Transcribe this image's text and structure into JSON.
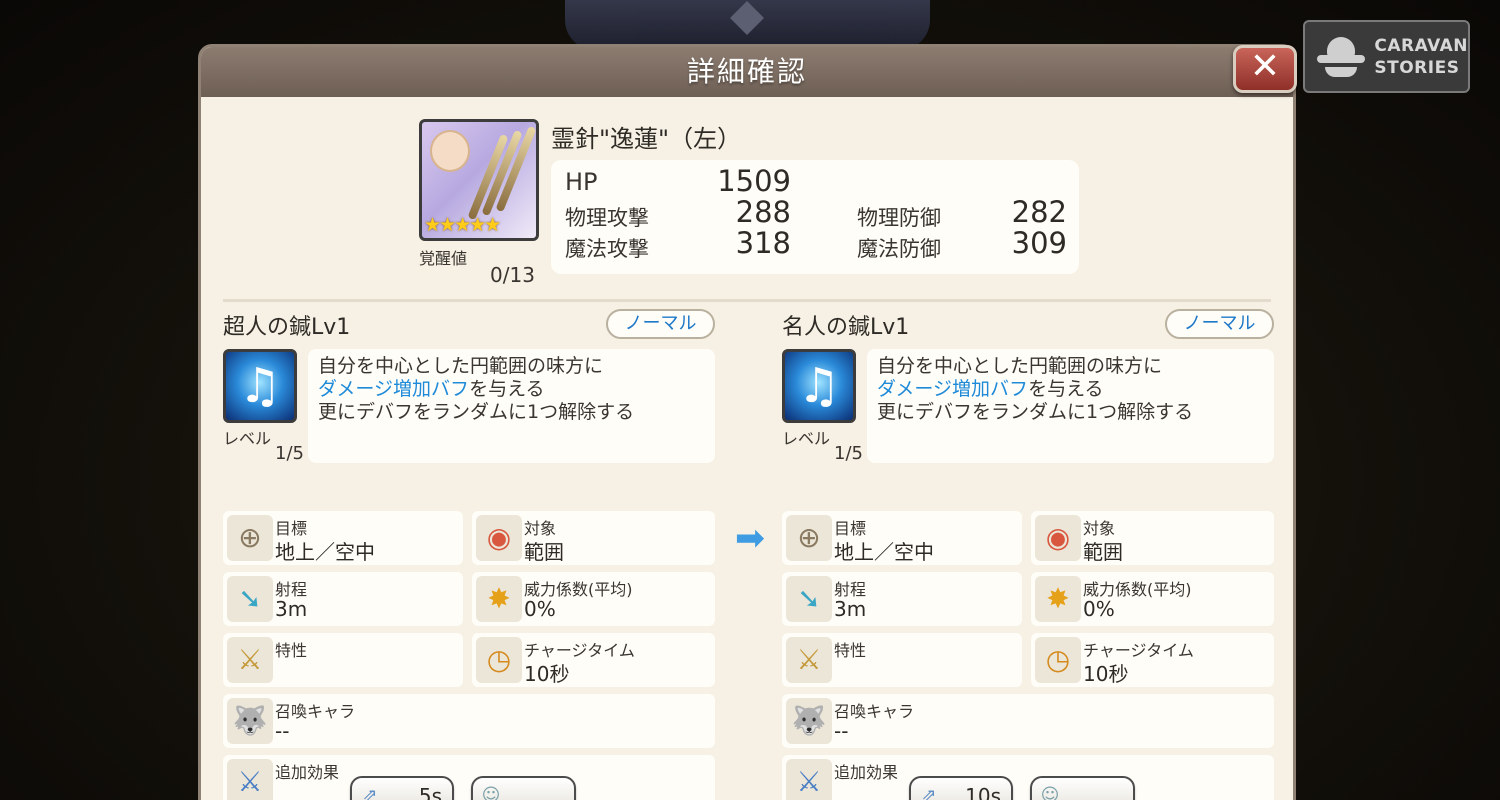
{
  "dialog": {
    "title": "詳細確認",
    "close_glyph": "✕"
  },
  "logo": {
    "line1": "CARAVAN",
    "line2": "STORIES"
  },
  "item": {
    "name": "霊針\"逸蓮\"（左）",
    "stars": "★★★★★",
    "awaken_label": "覚醒値",
    "awaken_value": "0/13",
    "stats": {
      "hp_label": "HP",
      "hp_value": "1509",
      "patk_label": "物理攻撃",
      "patk_value": "288",
      "pdef_label": "物理防御",
      "pdef_value": "282",
      "matk_label": "魔法攻撃",
      "matk_value": "318",
      "mdef_label": "魔法防御",
      "mdef_value": "309"
    }
  },
  "skills": [
    {
      "title": "超人の鍼Lv1",
      "badge": "ノーマル",
      "level_label": "レベル",
      "level_value": "1/5",
      "desc_line1": "自分を中心とした円範囲の味方に",
      "desc_highlight": "ダメージ増加バフ",
      "desc_line2_rest": "を与える",
      "desc_line3": "更にデバフをランダムに1つ解除する",
      "target_label": "目標",
      "target_value": "地上／空中",
      "scope_label": "対象",
      "scope_value": "範囲",
      "range_label": "射程",
      "range_value": "3m",
      "power_label": "威力係数(平均)",
      "power_value": "0%",
      "trait_label": "特性",
      "trait_value": "",
      "charge_label": "チャージタイム",
      "charge_value": "10秒",
      "summon_label": "召喚キャラ",
      "summon_value": "--",
      "extra_label": "追加効果",
      "effect_duration": "5s"
    },
    {
      "title": "名人の鍼Lv1",
      "badge": "ノーマル",
      "level_label": "レベル",
      "level_value": "1/5",
      "desc_line1": "自分を中心とした円範囲の味方に",
      "desc_highlight": "ダメージ増加バフ",
      "desc_line2_rest": "を与える",
      "desc_line3": "更にデバフをランダムに1つ解除する",
      "target_label": "目標",
      "target_value": "地上／空中",
      "scope_label": "対象",
      "scope_value": "範囲",
      "range_label": "射程",
      "range_value": "3m",
      "power_label": "威力係数(平均)",
      "power_value": "0%",
      "trait_label": "特性",
      "trait_value": "",
      "charge_label": "チャージタイム",
      "charge_value": "10秒",
      "summon_label": "召喚キャラ",
      "summon_value": "--",
      "extra_label": "追加効果",
      "effect_duration": "10s"
    }
  ],
  "colors": {
    "highlight_text": "#1e8ad8",
    "badge_text": "#1e78c8",
    "panel_bg": "#f6f1e4",
    "titlebar": "#7d6e63",
    "close_button": "#b04a40"
  },
  "icons": {
    "target": "crosshair-icon",
    "scope": "area-target-icon",
    "range": "arrow-range-icon",
    "power": "explosion-icon",
    "trait": "sword-icon",
    "charge": "clock-icon",
    "summon": "wolf-icon",
    "extra": "sword-plus-icon",
    "buff": "buff-up-icon",
    "debuff_clear": "cleanse-icon",
    "skill": "music-note-icon",
    "compare_arrow": "arrow-right-icon"
  }
}
